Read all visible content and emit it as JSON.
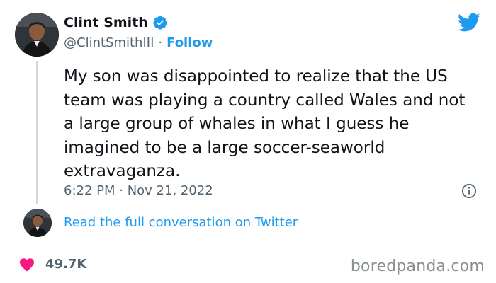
{
  "author": {
    "display_name": "Clint Smith",
    "handle": "@ClintSmithIII",
    "separator": "·",
    "follow_label": "Follow",
    "verified": true
  },
  "tweet": {
    "text": "My son was disappointed to realize that the US team was playing a country called Wales and not a large group of whales in what I guess he imagined to be a large soccer-seaworld extravaganza.",
    "timestamp": "6:22 PM · Nov 21, 2022"
  },
  "conversation_link": "Read the full conversation on Twitter",
  "engagement": {
    "likes": "49.7K"
  },
  "watermark": "boredpanda.com",
  "colors": {
    "accent": "#1d9bf0",
    "heart": "#f91880",
    "text": "#0f1419",
    "secondary": "#536471"
  },
  "icons": [
    "verified-badge-icon",
    "twitter-bird-icon",
    "info-icon",
    "heart-icon"
  ]
}
